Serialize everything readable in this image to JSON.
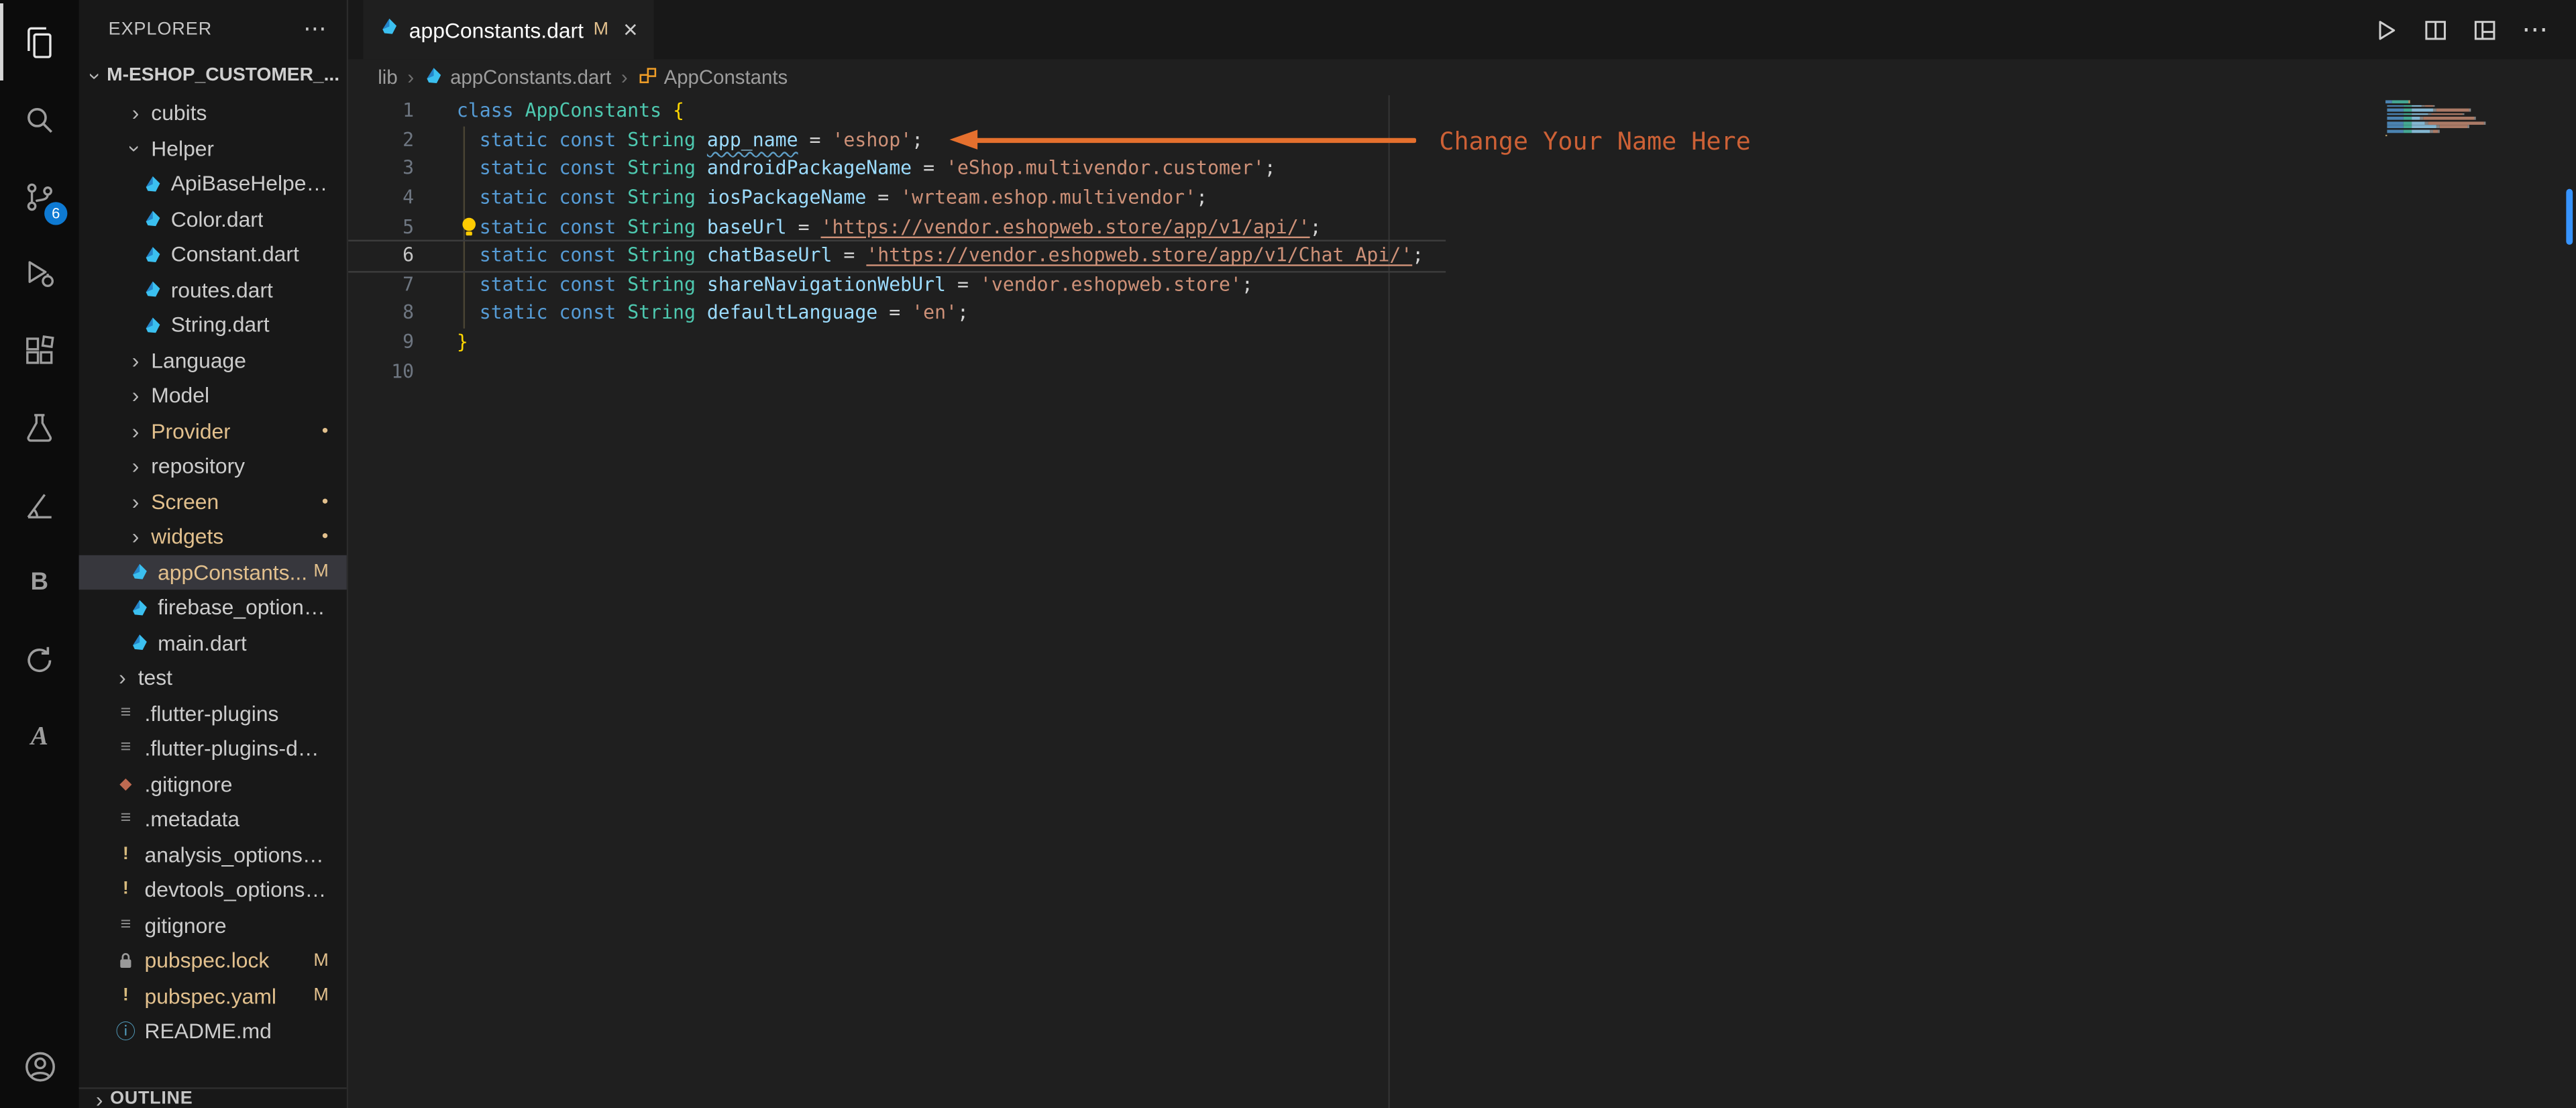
{
  "glyphs": {
    "chevron": "›",
    "dot": "●",
    "more": "⋯",
    "close": "×",
    "bloc": "B",
    "flutter_ext": "A"
  },
  "activity_bar": {
    "icons": [
      {
        "name": "explorer",
        "active": true
      },
      {
        "name": "search"
      },
      {
        "name": "source-control",
        "badge": "6"
      },
      {
        "name": "run-and-debug"
      },
      {
        "name": "extensions"
      },
      {
        "name": "testing"
      },
      {
        "name": "measure-tool"
      },
      {
        "name": "bloc-extension"
      },
      {
        "name": "sync-extension"
      },
      {
        "name": "flutter-extension"
      }
    ],
    "account": {
      "name": "accounts"
    }
  },
  "sidebar": {
    "header": {
      "title": "EXPLORER",
      "menu": "⋯"
    },
    "root": {
      "label": "M-ESHOP_CUSTOMER_...",
      "expanded": true
    },
    "items": [
      {
        "indent": 2,
        "chevron": "right",
        "label": "cubits"
      },
      {
        "indent": 2,
        "chevron": "down",
        "label": "Helper"
      },
      {
        "indent": 3,
        "icon": "dart",
        "label": "ApiBaseHelper.dart"
      },
      {
        "indent": 3,
        "icon": "dart",
        "label": "Color.dart"
      },
      {
        "indent": 3,
        "icon": "dart",
        "label": "Constant.dart"
      },
      {
        "indent": 3,
        "icon": "dart",
        "label": "routes.dart"
      },
      {
        "indent": 3,
        "icon": "dart",
        "label": "String.dart"
      },
      {
        "indent": 2,
        "chevron": "right",
        "label": "Language"
      },
      {
        "indent": 2,
        "chevron": "right",
        "label": "Model"
      },
      {
        "indent": 2,
        "chevron": "right",
        "label": "Provider",
        "mod": true,
        "dot": true
      },
      {
        "indent": 2,
        "chevron": "right",
        "label": "repository"
      },
      {
        "indent": 2,
        "chevron": "right",
        "label": "Screen",
        "mod": true,
        "dot": true
      },
      {
        "indent": 2,
        "chevron": "right",
        "label": "widgets",
        "mod": true,
        "dot": true
      },
      {
        "indent": 2,
        "icon": "dart",
        "label": "appConstants...",
        "mod": true,
        "badge": "M",
        "selected": true
      },
      {
        "indent": 2,
        "icon": "dart",
        "label": "firebase_options.d..."
      },
      {
        "indent": 2,
        "icon": "dart",
        "label": "main.dart"
      },
      {
        "indent": 1,
        "chevron": "right",
        "label": "test"
      },
      {
        "indent": 1,
        "icon": "list",
        "label": ".flutter-plugins"
      },
      {
        "indent": 1,
        "icon": "list",
        "label": ".flutter-plugins-dep..."
      },
      {
        "indent": 1,
        "icon": "diamond",
        "label": ".gitignore"
      },
      {
        "indent": 1,
        "icon": "list",
        "label": ".metadata"
      },
      {
        "indent": 1,
        "icon": "warn",
        "label": "analysis_options.yaml"
      },
      {
        "indent": 1,
        "icon": "warn",
        "label": "devtools_options.yaml"
      },
      {
        "indent": 1,
        "icon": "list",
        "label": "gitignore"
      },
      {
        "indent": 1,
        "icon": "lock",
        "label": "pubspec.lock",
        "mod": true,
        "badge": "M"
      },
      {
        "indent": 1,
        "icon": "warn",
        "label": "pubspec.yaml",
        "mod": true,
        "badge": "M"
      },
      {
        "indent": 1,
        "icon": "info",
        "label": "README.md"
      }
    ],
    "outline": {
      "label": "OUTLINE"
    }
  },
  "editor": {
    "tab": {
      "title": "appConstants.dart",
      "badge": "M",
      "close": "×"
    },
    "breadcrumbs": [
      {
        "label": "lib"
      },
      {
        "label": "appConstants.dart",
        "icon": "dart"
      },
      {
        "label": "AppConstants",
        "icon": "class"
      }
    ],
    "annotation": {
      "text": "Change Your Name Here",
      "arrow_color": "#e5702e",
      "text_color": "#cd6136"
    },
    "code": {
      "lines": [
        {
          "n": 1,
          "tokens": [
            [
              "class ",
              "kw"
            ],
            [
              "AppConstants ",
              "type"
            ],
            [
              "{",
              "brace"
            ]
          ]
        },
        {
          "n": 2,
          "tokens": [
            [
              "  ",
              "ws"
            ],
            [
              "static const ",
              "kw"
            ],
            [
              "String ",
              "type"
            ],
            [
              "app_name",
              "var wavy"
            ],
            [
              " = ",
              "op"
            ],
            [
              "'eshop'",
              "str"
            ],
            [
              ";",
              "op"
            ]
          ]
        },
        {
          "n": 3,
          "tokens": [
            [
              "  ",
              "ws"
            ],
            [
              "static const ",
              "kw"
            ],
            [
              "String ",
              "type"
            ],
            [
              "androidPackageName",
              "var"
            ],
            [
              " = ",
              "op"
            ],
            [
              "'eShop.multivendor.customer'",
              "str"
            ],
            [
              ";",
              "op"
            ]
          ]
        },
        {
          "n": 4,
          "tokens": [
            [
              "  ",
              "ws"
            ],
            [
              "static const ",
              "kw"
            ],
            [
              "String ",
              "type"
            ],
            [
              "iosPackageName",
              "var"
            ],
            [
              " = ",
              "op"
            ],
            [
              "'wrteam.eshop.multivendor'",
              "str"
            ],
            [
              ";",
              "op"
            ]
          ]
        },
        {
          "n": 5,
          "bulb": true,
          "tokens": [
            [
              "  ",
              "ws"
            ],
            [
              "static const ",
              "kw"
            ],
            [
              "String ",
              "type"
            ],
            [
              "baseUrl",
              "var"
            ],
            [
              " = ",
              "op"
            ],
            [
              "'https://vendor.eshopweb.store/app/v1/api/'",
              "str link"
            ],
            [
              ";",
              "op"
            ]
          ]
        },
        {
          "n": 6,
          "active": true,
          "tokens": [
            [
              "  ",
              "ws"
            ],
            [
              "static const ",
              "kw"
            ],
            [
              "String ",
              "type"
            ],
            [
              "chatBaseUrl",
              "var"
            ],
            [
              " = ",
              "op"
            ],
            [
              "'https://vendor.eshopweb.store/app/v1/Chat_Api/'",
              "str link"
            ],
            [
              ";",
              "op"
            ]
          ]
        },
        {
          "n": 7,
          "tokens": [
            [
              "  ",
              "ws"
            ],
            [
              "static const ",
              "kw"
            ],
            [
              "String ",
              "type"
            ],
            [
              "shareNavigationWebUrl",
              "var"
            ],
            [
              " = ",
              "op"
            ],
            [
              "'vendor.eshopweb.store'",
              "str"
            ],
            [
              ";",
              "op"
            ]
          ]
        },
        {
          "n": 8,
          "tokens": [
            [
              "  ",
              "ws"
            ],
            [
              "static const ",
              "kw"
            ],
            [
              "String ",
              "type"
            ],
            [
              "defaultLanguage",
              "var"
            ],
            [
              " = ",
              "op"
            ],
            [
              "'en'",
              "str"
            ],
            [
              ";",
              "op"
            ]
          ]
        },
        {
          "n": 9,
          "tokens": [
            [
              "}",
              "brace"
            ]
          ]
        },
        {
          "n": 10,
          "tokens": []
        }
      ]
    }
  }
}
